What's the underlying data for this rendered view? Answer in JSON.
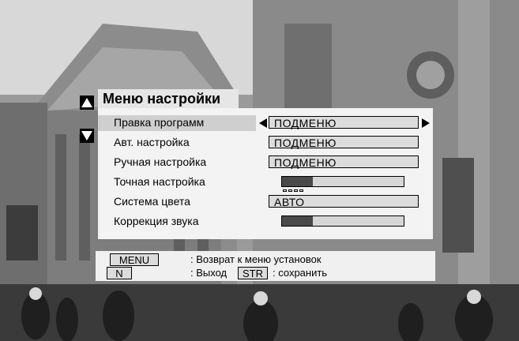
{
  "menu": {
    "title": "Меню настройки",
    "items": [
      {
        "label": "Правка программ",
        "value": "ПОДМЕНЮ",
        "type": "submenu",
        "selected": true
      },
      {
        "label": "Авт. настройка",
        "value": "ПОДМЕНЮ",
        "type": "submenu"
      },
      {
        "label": "Ручная настройка",
        "value": "ПОДМЕНЮ",
        "type": "submenu"
      },
      {
        "label": "Точная настройка",
        "type": "slider",
        "level": 0.25
      },
      {
        "label": "Система цвета",
        "value": "АВТО",
        "type": "value"
      },
      {
        "label": "Коррекция звука",
        "type": "slider",
        "level": 0.25
      }
    ]
  },
  "help": {
    "menu_key": "MENU",
    "menu_text": ": Возврат к меню установок",
    "n_key": "N",
    "exit_text": ": Выход",
    "str_key": "STR",
    "save_text": ": сохранить"
  },
  "icons": {
    "up": "up-triangle-icon",
    "down": "down-triangle-icon",
    "left": "left-triangle-icon",
    "right": "right-triangle-icon"
  },
  "colors": {
    "panel": "#f3f3f3",
    "field": "#dcdcdc",
    "slider_fill": "#4a4a4a"
  }
}
